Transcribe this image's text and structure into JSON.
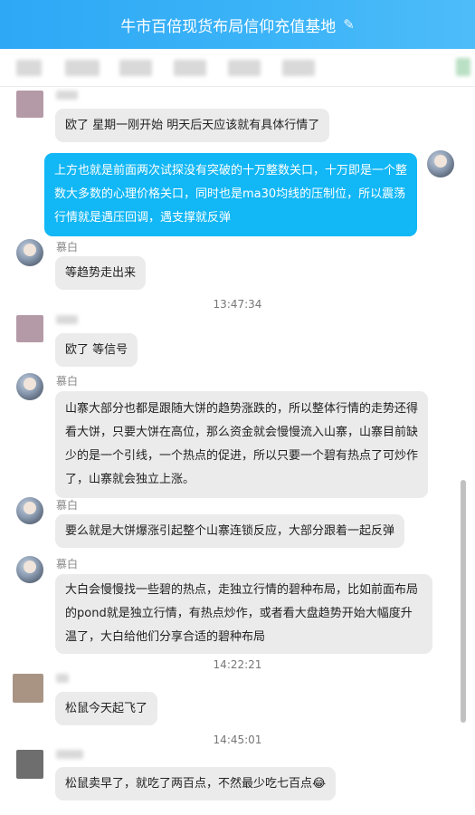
{
  "window": {
    "title": "牛市百倍现货布局信仰充值基地",
    "edit_icon": "✎"
  },
  "messages": {
    "m1": {
      "text": "欧了 星期一刚开始 明天后天应该就有具体行情了"
    },
    "m2": {
      "text": "上方也就是前面两次试探没有突破的十万整数关口，十万即是一个整数大多数的心理价格关口，同时也是ma30均线的压制位，所以震荡行情就是遇压回调，遇支撑就反弹"
    },
    "m3": {
      "sender": "慕白",
      "text": "等趋势走出来"
    },
    "t1": "13:47:34",
    "m4": {
      "text": "欧了 等信号"
    },
    "m5": {
      "sender": "慕白",
      "text": "山寨大部分也都是跟随大饼的趋势涨跌的，所以整体行情的走势还得看大饼，只要大饼在高位，那么资金就会慢慢流入山寨，山寨目前缺少的是一个引线，一个热点的促进，所以只要一个碧有热点了可炒作了，山寨就会独立上涨。"
    },
    "m6": {
      "sender": "慕白",
      "text": "要么就是大饼爆涨引起整个山寨连锁反应，大部分跟着一起反弹"
    },
    "m7": {
      "sender": "慕白",
      "text": "大白会慢慢找一些碧的热点，走独立行情的碧种布局，比如前面布局的pond就是独立行情，有热点炒作，或者看大盘趋势开始大幅度升温了，大白给他们分享合适的碧种布局"
    },
    "t2": "14:22:21",
    "m8": {
      "text": "松鼠今天起飞了"
    },
    "t3": "14:45:01",
    "m9": {
      "text": "松鼠卖早了，就吃了两百点，不然最少吃七百点😂"
    }
  },
  "colors": {
    "title_bar": "#2ea8f5",
    "own_bubble": "#12b7f5",
    "other_bubble": "#ebebeb"
  }
}
